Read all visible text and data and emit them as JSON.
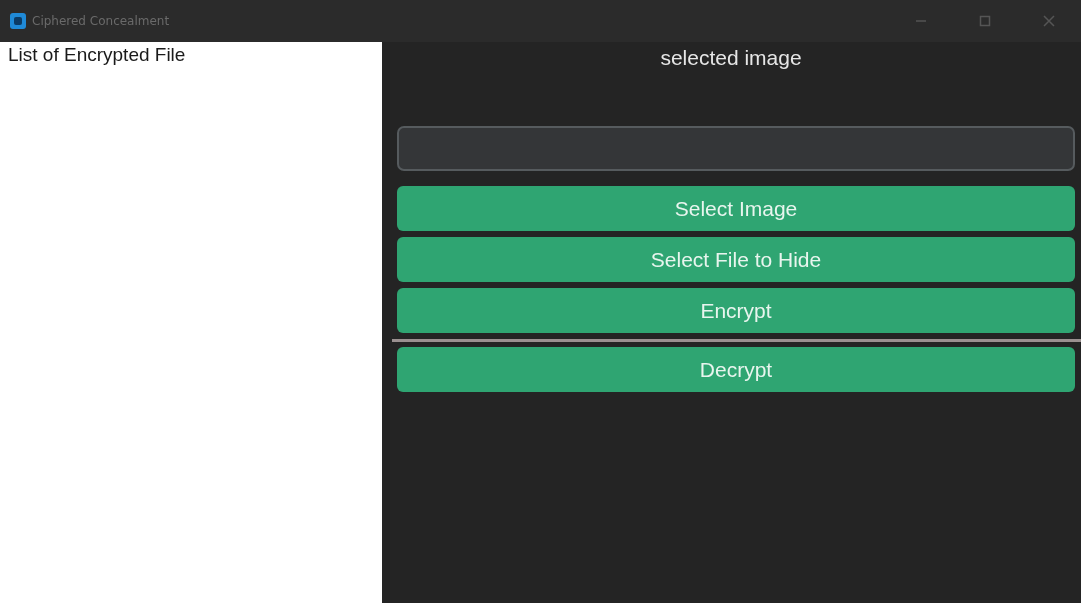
{
  "window": {
    "title": "Ciphered Concealment"
  },
  "file_list": {
    "heading": "List of Encrypted File"
  },
  "main": {
    "heading": "selected image",
    "items": [
      {
        "kind": "button",
        "label": "Select Image"
      },
      {
        "kind": "button",
        "label": "Select File to Hide"
      },
      {
        "kind": "button",
        "label": "Encrypt"
      },
      {
        "kind": "separator"
      },
      {
        "kind": "button",
        "label": "Decrypt"
      }
    ]
  }
}
